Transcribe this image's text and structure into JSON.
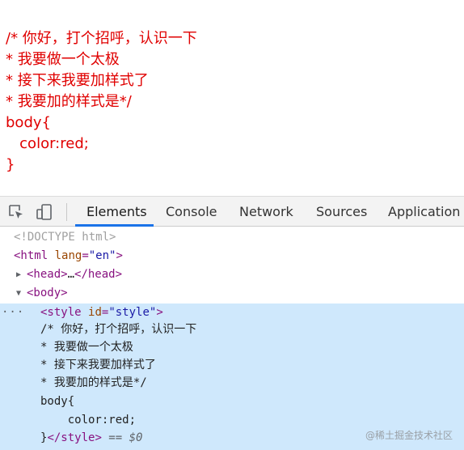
{
  "page": {
    "lines": [
      "/* 你好，打个招呼，认识一下",
      "* 我要做一个太极",
      "* 接下来我要加样式了",
      "* 我要加的样式是*/",
      "body{",
      "   color:red;",
      "}"
    ],
    "text_color": "#e00000"
  },
  "devtools": {
    "toolbar": {
      "inspect_icon": "inspect-element-icon",
      "device_icon": "device-toolbar-icon",
      "tabs": [
        "Elements",
        "Console",
        "Network",
        "Sources",
        "Application"
      ],
      "active_tab": "Elements",
      "accent": "#1a73e8"
    },
    "tree": {
      "doctype": "<!DOCTYPE html>",
      "html_open": "<html",
      "html_attr": "lang",
      "html_eq": "=",
      "html_val": "\"en\"",
      "html_close": ">",
      "head_toggle": "▶",
      "head_open": "<head>",
      "head_ellipsis": "…",
      "head_close": "</head>",
      "body_toggle": "▼",
      "body_open": "<body>",
      "more_dots": "···",
      "style_open": "<style",
      "style_attr": "id",
      "style_eq": "=",
      "style_val": "\"style\"",
      "style_close": ">",
      "style_lines": [
        "/* 你好，打个招呼，认识一下",
        "* 我要做一个太极",
        "* 接下来我要加样式了",
        "* 我要加的样式是*/",
        "body{",
        "    color:red;"
      ],
      "style_last_text": "}",
      "style_end_tag": "</style>",
      "selected_marker": " == $0",
      "selected_bg": "#cfe8fc"
    },
    "watermark": "@稀土掘金技术社区"
  }
}
